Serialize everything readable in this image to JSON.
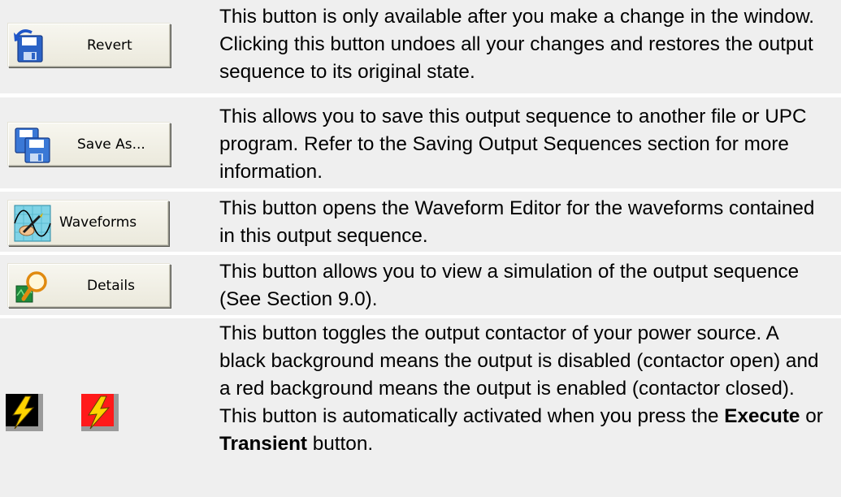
{
  "rows": [
    {
      "button_label": "Revert",
      "icon": "revert-icon",
      "description": "This button is only available after you make a change in the window. Clicking this button undoes all your changes and restores the output sequence to its original state."
    },
    {
      "button_label": "Save As...",
      "icon": "save-as-icon",
      "description": "This allows you to save this output sequence to another file or UPC program. Refer to the Saving Output Sequences section for more information."
    },
    {
      "button_label": "Waveforms",
      "icon": "waveform-icon",
      "description": "This button opens the Waveform Editor for the waveforms contained in this output sequence."
    },
    {
      "button_label": "Details",
      "icon": "details-icon",
      "description": "This button allows you to view a simulation of the output sequence (See Section 9.0)."
    },
    {
      "icons": [
        "contactor-disabled-icon",
        "contactor-enabled-icon"
      ],
      "description_part1": "This button toggles the output contactor of your power source. A black background means the output is disabled (contactor open) and a red background means the output is enabled (contactor closed). This button is automatically activated when you press the ",
      "bold1": "Execute",
      "description_mid": " or ",
      "bold2": "Transient",
      "description_part2": " button."
    }
  ],
  "colors": {
    "row_background": "#efefef",
    "contactor_disabled_bg": "#000000",
    "contactor_enabled_bg": "#ff1a1a",
    "bolt_yellow": "#ffd400"
  }
}
